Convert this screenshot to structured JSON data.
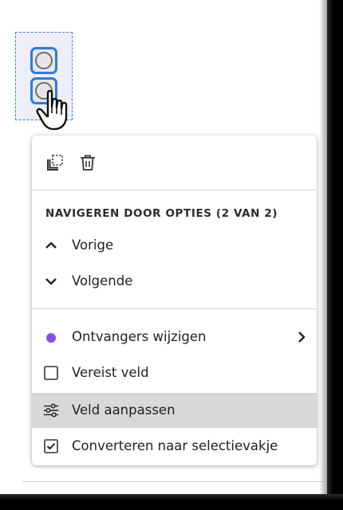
{
  "canvas": {
    "radio_group": {
      "option_count": 2
    }
  },
  "menu": {
    "toolbar": {
      "icons": [
        "duplicate-icon",
        "trash-icon"
      ]
    },
    "section_title": "NAVIGEREN DOOR OPTIES (2 VAN 2)",
    "nav_items": [
      {
        "label": "Vorige",
        "icon": "chevron-up-icon"
      },
      {
        "label": "Volgende",
        "icon": "chevron-down-icon"
      }
    ],
    "items": [
      {
        "label": "Ontvangers wijzigen",
        "icon": "recipient-dot-icon",
        "has_submenu": true
      },
      {
        "label": "Vereist veld",
        "icon": "checkbox-unchecked-icon",
        "checked": false
      },
      {
        "label": "Veld aanpassen",
        "icon": "sliders-icon",
        "highlighted": true
      },
      {
        "label": "Converteren naar selectievakje",
        "icon": "checkbox-checked-icon",
        "checked": true
      }
    ]
  },
  "colors": {
    "selection_border": "#3b82e0",
    "selection_fill": "#eeeef8",
    "radio_border": "#2f7bdb",
    "recipient_dot": "#8a4fe8",
    "highlight_bg": "#d8d8d8"
  }
}
